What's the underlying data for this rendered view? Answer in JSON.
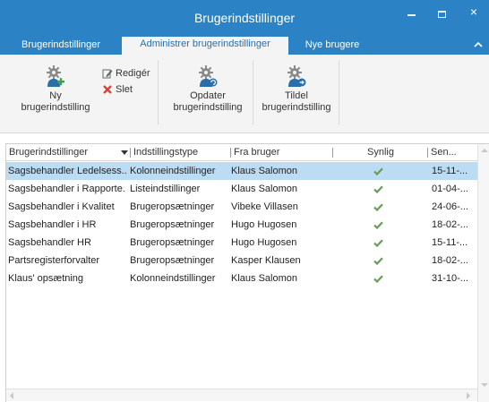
{
  "window": {
    "title": "Brugerindstillinger",
    "accent": "#2b83c6",
    "minimize_icon": "minimize-icon",
    "maximize_icon": "maximize-icon",
    "close_label": "×"
  },
  "tabs": [
    {
      "label": "Brugerindstillinger",
      "selected": false
    },
    {
      "label": "Administrer brugerindstillinger",
      "selected": true
    },
    {
      "label": "Nye brugere",
      "selected": false
    }
  ],
  "ribbon": {
    "new_label_1": "Ny",
    "new_label_2": "brugerindstilling",
    "edit_label": "Redigér",
    "delete_label": "Slet",
    "update_label_1": "Opdater",
    "update_label_2": "brugerindstilling",
    "assign_label_1": "Tildel",
    "assign_label_2": "brugerindstilling"
  },
  "table": {
    "columns": [
      "Brugerindstillinger",
      "Indstillingstype",
      "Fra bruger",
      "Synlig",
      "Sen..."
    ],
    "selected_color": "#bcdcf4",
    "check_color": "#6a9a5a",
    "rows": [
      {
        "name": "Sagsbehandler Ledelsess...",
        "type": "Kolonneindstillinger",
        "user": "Klaus Salomon",
        "visible": true,
        "date": "15-11-..."
      },
      {
        "name": "Sagsbehandler i Rapporte...",
        "type": "Listeindstillinger",
        "user": "Klaus Salomon",
        "visible": true,
        "date": "01-04-..."
      },
      {
        "name": "Sagsbehandler i Kvalitet",
        "type": "Brugeropsætninger",
        "user": "Vibeke Villasen",
        "visible": true,
        "date": "24-06-..."
      },
      {
        "name": "Sagsbehandler i HR",
        "type": "Brugeropsætninger",
        "user": "Hugo Hugosen",
        "visible": true,
        "date": "18-02-..."
      },
      {
        "name": "Sagsbehandler HR",
        "type": "Brugeropsætninger",
        "user": "Hugo Hugosen",
        "visible": true,
        "date": "15-11-..."
      },
      {
        "name": "Partsregisterforvalter",
        "type": "Brugeropsætninger",
        "user": "Kasper Klausen",
        "visible": true,
        "date": "18-02-..."
      },
      {
        "name": "Klaus' opsætning",
        "type": "Kolonneindstillinger",
        "user": "Klaus Salomon",
        "visible": true,
        "date": "31-10-..."
      }
    ]
  }
}
